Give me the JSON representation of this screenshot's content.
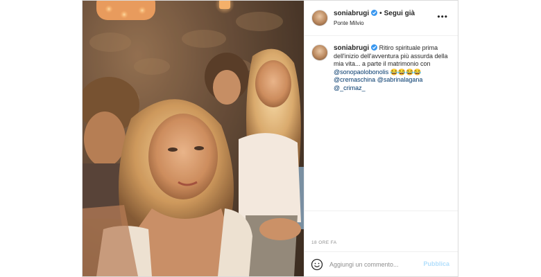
{
  "header": {
    "username": "soniabrugi",
    "follow_label": "Segui già",
    "location": "Ponte Milvio",
    "more_icon": "ellipsis-horizontal-icon"
  },
  "caption": {
    "username": "soniabrugi",
    "text": "Ritiro spirituale prima dell'inizio dell'avventura più assurda della mia vita... a parte il matrimonio con ",
    "mention_main": "@sonopaolobonolis",
    "emojis": "😂😂😂😂",
    "mentions": [
      "@cremaschina",
      "@sabrinalagana",
      "@_crimaz_"
    ]
  },
  "time": "18 ORE FA",
  "comment": {
    "placeholder": "Aggiungi un commento...",
    "publish_label": "Pubblica",
    "emoji_icon": "smiley-icon"
  },
  "colors": {
    "verified": "#3897f0",
    "mention": "#00376b",
    "publish_disabled": "#b2dffc"
  }
}
